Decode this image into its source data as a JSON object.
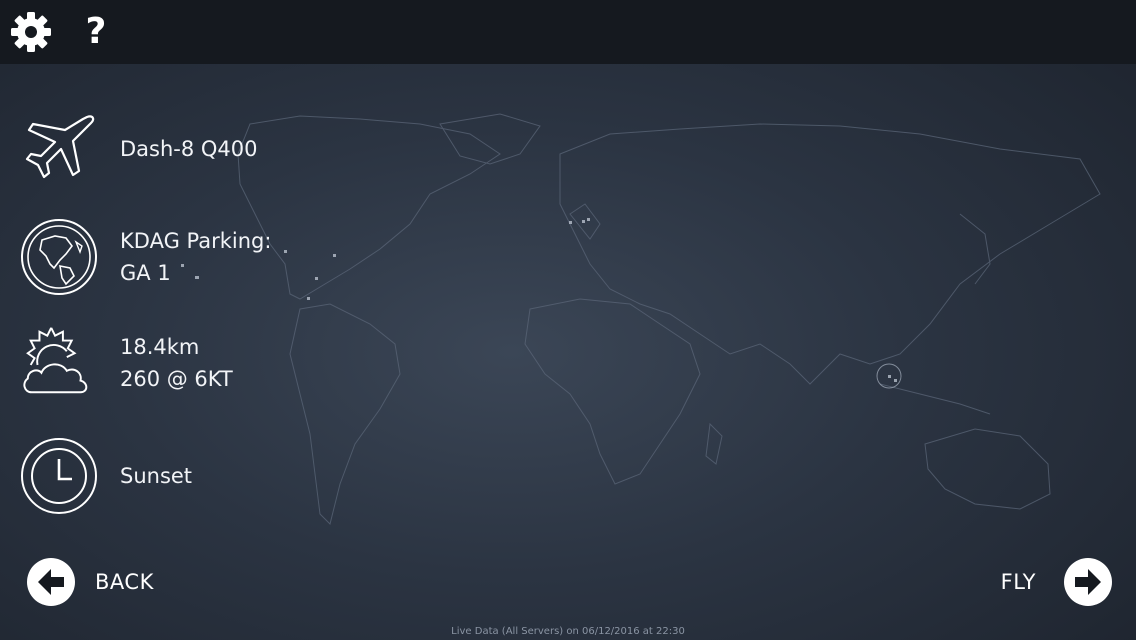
{
  "toolbar": {
    "settings_icon": "gear-icon",
    "help_icon": "question-icon",
    "help_glyph": "?"
  },
  "flight": {
    "aircraft": {
      "icon": "airplane-icon",
      "label": "Dash-8 Q400"
    },
    "location": {
      "icon": "globe-icon",
      "line1": "KDAG Parking:",
      "line2": "GA 1"
    },
    "weather": {
      "icon": "weather-sun-cloud-icon",
      "line1": "18.4km",
      "line2": "260 @ 6KT"
    },
    "time": {
      "icon": "clock-icon",
      "label": "Sunset"
    }
  },
  "nav": {
    "back_label": "BACK",
    "fly_label": "FLY"
  },
  "footer": {
    "status": "Live Data (All Servers) on 06/12/2016 at 22:30"
  },
  "colors": {
    "topbar": "#15191f",
    "background": "#2b3442",
    "text": "#ffffff",
    "map_outline": "#5a6577"
  }
}
